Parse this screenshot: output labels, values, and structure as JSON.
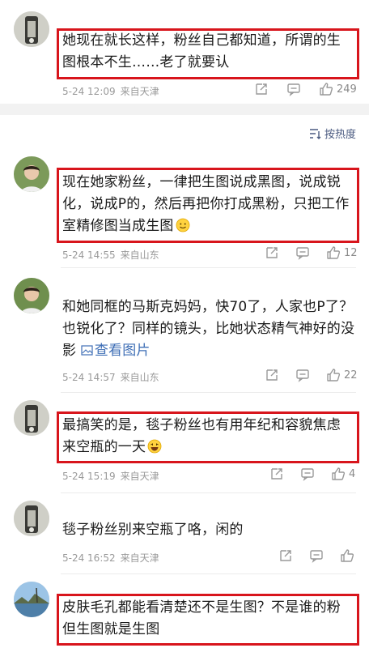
{
  "sort": {
    "label": "按热度"
  },
  "comments": [
    {
      "text": "她现在就长这样，粉丝自己都知道，所谓的生图根本不生……老了就要认",
      "date": "5-24 12:09",
      "location": "来自天津",
      "likes": "249"
    },
    {
      "text": "现在她家粉丝，一律把生图说成黑图，说成锐化，说成P的，然后再把你打成黑粉，只把工作室精修图当成生图",
      "date": "5-24 14:55",
      "location": "来自山东",
      "likes": "12"
    },
    {
      "text": "和她同框的马斯克妈妈，快70了，人家也P了？也锐化了？同样的镜头，比她状态精气神好的没影",
      "link": "查看图片",
      "date": "5-24 14:57",
      "location": "来自山东",
      "likes": "22"
    },
    {
      "text": "最搞笑的是，毯子粉丝也有用年纪和容貌焦虑来空瓶的一天",
      "date": "5-24 15:19",
      "location": "来自天津",
      "likes": "4"
    },
    {
      "text": "毯子粉丝别来空瓶了咯，闲的",
      "date": "5-24 16:52",
      "location": "来自天津",
      "likes": ""
    },
    {
      "text": "皮肤毛孔都能看清楚还不是生图？不是谁的粉但生图就是生图"
    }
  ],
  "colors": {
    "highlight": "#d8151c",
    "meta": "#9a9a9a",
    "link": "#3f6fb6"
  }
}
